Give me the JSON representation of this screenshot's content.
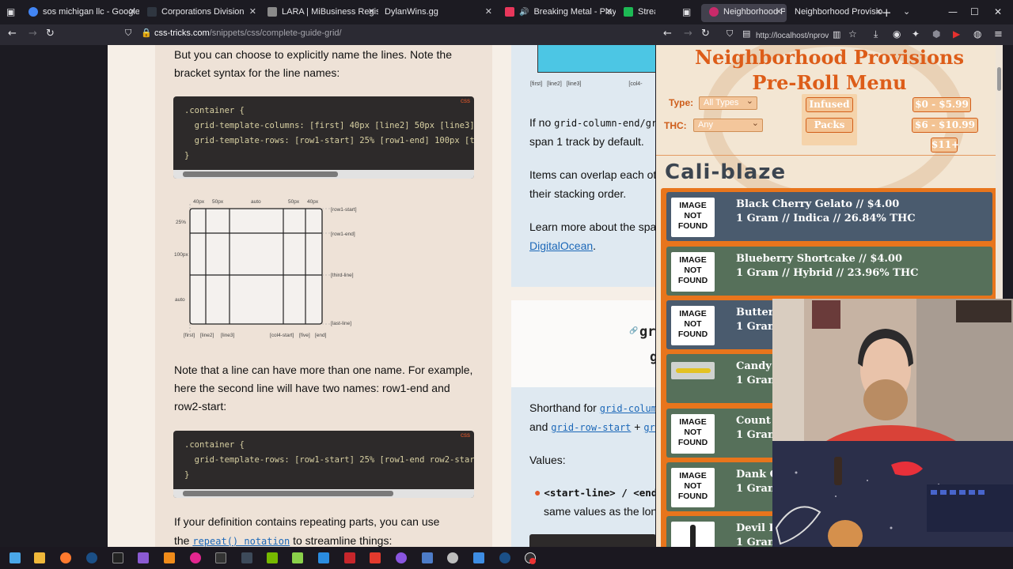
{
  "left_browser": {
    "tabs": [
      {
        "title": "sos michigan llc - Google Search",
        "color": "#4285f4"
      },
      {
        "title": "Corporations Division",
        "color": "#2f3640"
      },
      {
        "title": "LARA | MiBusiness Registry Porta",
        "color": "#8a8a8a"
      },
      {
        "title": "DylanWins.gg",
        "color": "#2f3640"
      },
      {
        "title": "Breaking Metal - Playlist - A",
        "color": "#e8375b"
      },
      {
        "title": "Stream",
        "color": "#1db954"
      }
    ],
    "url_domain": "css-tricks.com",
    "url_path": "/snippets/css/complete-guide-grid/",
    "content": {
      "p1": "But you can choose to explicitly name the lines. Note the bracket syntax for the line names:",
      "code1_tag": "css",
      "code1_lines": [
        ".container {",
        "  grid-template-columns: [first] 40px [line2] 50px [line3] au",
        "  grid-template-rows: [row1-start] 25% [row1-end] 100px [thir",
        "}"
      ],
      "diagram": {
        "top_labels": [
          "40px",
          "50px",
          "auto",
          "50px",
          "40px"
        ],
        "left_labels": [
          "25%",
          "100px",
          "auto"
        ],
        "right_labels": [
          "[row1-start]",
          "[row1-end]",
          "[third-line]",
          "[last-line]"
        ],
        "bottom_labels": [
          "[first]",
          "[line2]",
          "[line3]",
          "[col4-start]",
          "[five]",
          "[end]"
        ]
      },
      "p2": "Note that a line can have more than one name. For example, here the second line will have two names: row1-end and row2-start:",
      "code2_tag": "css",
      "code2_lines": [
        ".container {",
        "  grid-template-rows: [row1-start] 25% [row1-end row2-start]",
        "}"
      ],
      "p3": "If your definition contains repeating parts, you can use",
      "p4_pre": "the",
      "p4_link": "repeat() notation",
      "p4_post": "to streamline things:",
      "right_col": {
        "diagram_labels": [
          "[first]",
          "[line2]",
          "[line3]",
          "[col4-"
        ],
        "r1_pre": "If no",
        "r1_code": "grid-column-end/gri",
        "r1_line2": "span 1 track by default.",
        "r2_line1": "Items can overlap each ot",
        "r2_line2": "their stacking order.",
        "r3_line1": "Learn more about the spa",
        "r3_link": "DigitalOcean",
        "r3_post": ".",
        "heading_frag1": "gr",
        "heading_frag2": "g",
        "r4_pre": "Shorthand for",
        "r4_code": "grid-colum",
        "r5_pre": "and",
        "r5_code1": "grid-row-start",
        "r5_mid": "+",
        "r5_code2": "gri",
        "r6": "Values:",
        "r7_code": "<start-line> / <end",
        "r8": "same values as the lon"
      }
    }
  },
  "right_browser": {
    "tabs": [
      {
        "title": "Neighborhood Provis",
        "active": true
      },
      {
        "title": "Neighborhood Provision",
        "active": false
      }
    ],
    "url": "http://localhost/nprov",
    "site": {
      "title_line1": "Neighborhood Provisions",
      "title_line2": "Pre-Roll Menu",
      "type_label": "Type:",
      "type_value": "All Types",
      "thc_label": "THC:",
      "thc_value": "Any",
      "pills": [
        "Infused",
        "Packs",
        "$0 - $5.99",
        "$6 - $10.99",
        "$11+"
      ],
      "category": "Cali-blaze",
      "products": [
        {
          "image": "IMAGE NOT FOUND",
          "line1": "Black Cherry Gelato // $4.00",
          "line2": "1 Gram // Indica // 26.84% THC",
          "bg": "#4a5b6e"
        },
        {
          "image": "IMAGE NOT FOUND",
          "line1": "Blueberry Shortcake // $4.00",
          "line2": "1 Gram // Hybrid // 23.96% THC",
          "bg": "#56705a"
        },
        {
          "image": "IMAGE NOT FOUND",
          "line1": "Butter P",
          "line2": "1 Gram",
          "bg": "#4a5b6e"
        },
        {
          "image": "",
          "line1": "Candy S",
          "line2": "1 Gram",
          "bg": "#56705a"
        },
        {
          "image": "IMAGE NOT FOUND",
          "line1": "Count C",
          "line2": "1 Gram",
          "bg": "#56705a"
        },
        {
          "image": "IMAGE NOT FOUND",
          "line1": "Dank C",
          "line2": "1 Gram",
          "bg": "#56705a"
        },
        {
          "image": "",
          "line1": "Devil Dr",
          "line2": "1 Gram",
          "bg": "#56705a"
        }
      ]
    }
  },
  "taskbar": {
    "icons": [
      "windows-start-icon",
      "file-explorer-icon",
      "firefox-icon",
      "steam-icon",
      "epic-games-icon",
      "visual-studio-icon",
      "vlc-icon",
      "app-pink-icon",
      "terminal-icon",
      "app-dark-icon",
      "nvidia-icon",
      "notepad-plus-icon",
      "vscode-icon",
      "filezilla-icon",
      "app-red-icon",
      "app-purple-icon",
      "app-blue-icon",
      "app-gray-icon",
      "app-blue2-icon",
      "steam2-icon",
      "obs-icon"
    ]
  }
}
